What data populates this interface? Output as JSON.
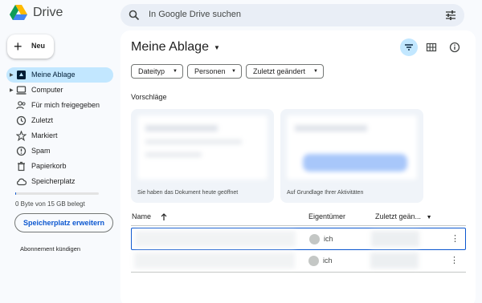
{
  "app": {
    "name": "Drive"
  },
  "search": {
    "placeholder": "In Google Drive suchen"
  },
  "new_button": {
    "label": "Neu"
  },
  "sidebar": {
    "items": [
      {
        "label": "Meine Ablage",
        "icon": "my-drive-icon",
        "active": true
      },
      {
        "label": "Computer",
        "icon": "computer-icon"
      },
      {
        "label": "Für mich freigegeben",
        "icon": "shared-icon"
      },
      {
        "label": "Zuletzt",
        "icon": "recent-icon"
      },
      {
        "label": "Markiert",
        "icon": "star-icon"
      },
      {
        "label": "Spam",
        "icon": "spam-icon"
      },
      {
        "label": "Papierkorb",
        "icon": "trash-icon"
      },
      {
        "label": "Speicherplatz",
        "icon": "cloud-icon"
      }
    ],
    "storage_text": "0 Byte von 15 GB belegt",
    "storage_used_fraction": 0.01,
    "upgrade_label": "Speicherplatz erweitern",
    "cancel_label": "Abonnement kündigen"
  },
  "main": {
    "title": "Meine Ablage",
    "filters": [
      {
        "label": "Dateityp"
      },
      {
        "label": "Personen"
      },
      {
        "label": "Zuletzt geändert"
      }
    ],
    "suggestions_label": "Vorschläge",
    "cards": [
      {
        "caption": "Sie haben das Dokument heute geöffnet"
      },
      {
        "caption": "Auf Grundlage Ihrer Aktivitäten"
      }
    ],
    "columns": {
      "name": "Name",
      "owner": "Eigentümer",
      "modified": "Zuletzt geän..."
    },
    "rows": [
      {
        "owner": "ich"
      },
      {
        "owner": "ich"
      }
    ]
  },
  "colors": {
    "accent": "#0b57d0",
    "active_bg": "#c2e7ff",
    "search_bg": "#e9eef6",
    "page_bg": "#f8fafd"
  }
}
